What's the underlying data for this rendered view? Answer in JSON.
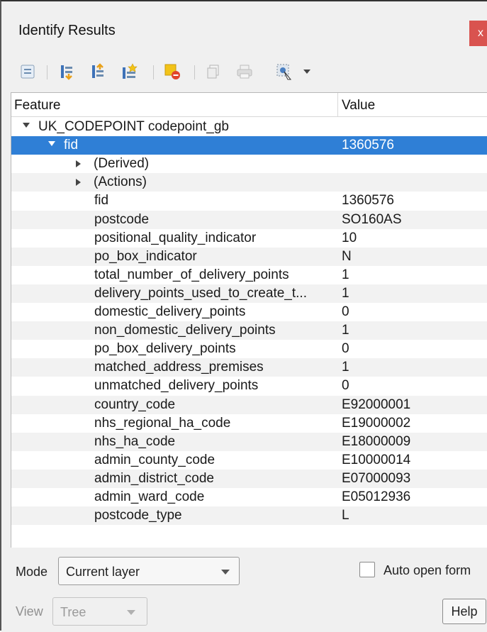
{
  "window": {
    "title": "Identify Results",
    "close_glyph": "x"
  },
  "toolbar": {
    "icons": [
      "expand-tree-icon",
      "expand-all-icon",
      "collapse-all-icon",
      "expand-new-results-icon",
      "clear-highlights-icon",
      "copy-feature-icon",
      "print-icon",
      "identify-selection-icon",
      "dropdown-icon"
    ]
  },
  "table": {
    "headers": {
      "feature": "Feature",
      "value": "Value"
    },
    "layer": {
      "label": "UK_CODEPOINT codepoint_gb"
    },
    "feature_row": {
      "label": "fid",
      "value": "1360576"
    },
    "groups": [
      {
        "label": "(Derived)"
      },
      {
        "label": "(Actions)"
      }
    ],
    "attributes": [
      {
        "name": "fid",
        "value": "1360576"
      },
      {
        "name": "postcode",
        "value": "SO160AS"
      },
      {
        "name": "positional_quality_indicator",
        "value": "10"
      },
      {
        "name": "po_box_indicator",
        "value": "N"
      },
      {
        "name": "total_number_of_delivery_points",
        "value": "1"
      },
      {
        "name": "delivery_points_used_to_create_t...",
        "value": "1"
      },
      {
        "name": "domestic_delivery_points",
        "value": "0"
      },
      {
        "name": "non_domestic_delivery_points",
        "value": "1"
      },
      {
        "name": "po_box_delivery_points",
        "value": "0"
      },
      {
        "name": "matched_address_premises",
        "value": "1"
      },
      {
        "name": "unmatched_delivery_points",
        "value": "0"
      },
      {
        "name": "country_code",
        "value": "E92000001"
      },
      {
        "name": "nhs_regional_ha_code",
        "value": "E19000002"
      },
      {
        "name": "nhs_ha_code",
        "value": "E18000009"
      },
      {
        "name": "admin_county_code",
        "value": "E10000014"
      },
      {
        "name": "admin_district_code",
        "value": "E07000093"
      },
      {
        "name": "admin_ward_code",
        "value": "E05012936"
      },
      {
        "name": "postcode_type",
        "value": "L"
      }
    ]
  },
  "footer": {
    "mode_label": "Mode",
    "mode_value": "Current layer",
    "auto_open_label": "Auto open form",
    "view_label": "View",
    "view_value": "Tree",
    "help_label": "Help"
  },
  "colors": {
    "selection": "#2f7fd6",
    "close": "#d9534f"
  }
}
